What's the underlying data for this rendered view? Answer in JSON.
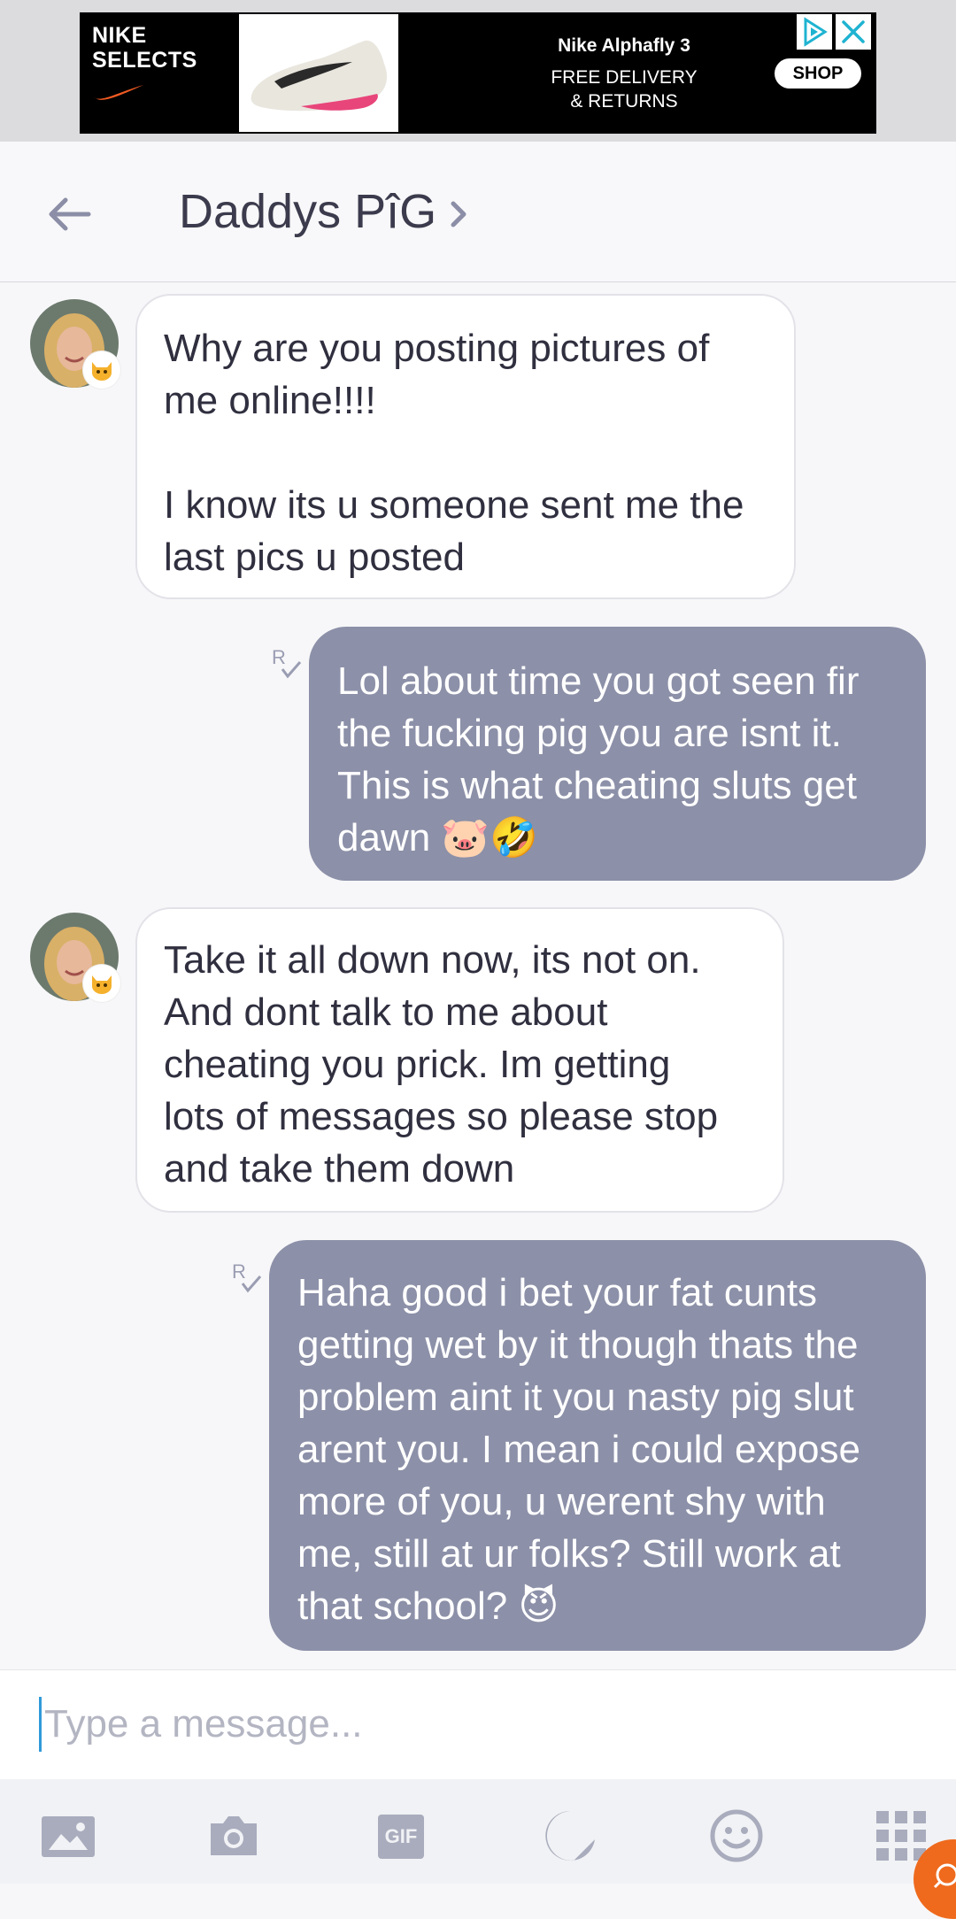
{
  "ad": {
    "brand": "NIKE\nSELECTS",
    "title": "Nike Alphafly 3",
    "subtitle_line1": "FREE DELIVERY",
    "subtitle_line2": "& RETURNS",
    "cta": "SHOP"
  },
  "header": {
    "title": "Daddys PîG"
  },
  "messages": [
    {
      "direction": "incoming",
      "text": "Why are you posting pictures of\nme online!!!!\n\nI know its u someone sent me the\nlast pics u posted"
    },
    {
      "direction": "outgoing",
      "read": "R",
      "text": "Lol about time you got seen fir\nthe fucking pig you are isnt it.\nThis is what cheating sluts get\ndawn 🐷🤣"
    },
    {
      "direction": "incoming",
      "text": "Take it all down now, its not on.\nAnd dont talk to me about\ncheating you prick. Im getting\nlots of messages so please stop\nand take them down"
    },
    {
      "direction": "outgoing",
      "read": "R",
      "text": "Haha good i bet your fat cunts\ngetting wet by it though thats the\nproblem aint it you nasty pig slut\narent you. I mean i could expose\nmore of you, u werent shy with\nme, still at ur folks? Still work at\nthat school? 😈"
    }
  ],
  "composer": {
    "placeholder": "Type a message...",
    "value": ""
  },
  "toolbar": {
    "gif_label": "GIF",
    "icons": [
      "photo-icon",
      "camera-icon",
      "gif-icon",
      "sticker-icon",
      "emoji-icon",
      "apps-grid-icon"
    ]
  },
  "colors": {
    "outgoing_bubble": "#8c90a8",
    "incoming_bubble": "#ffffff",
    "accent_caret": "#2f9ad9"
  }
}
